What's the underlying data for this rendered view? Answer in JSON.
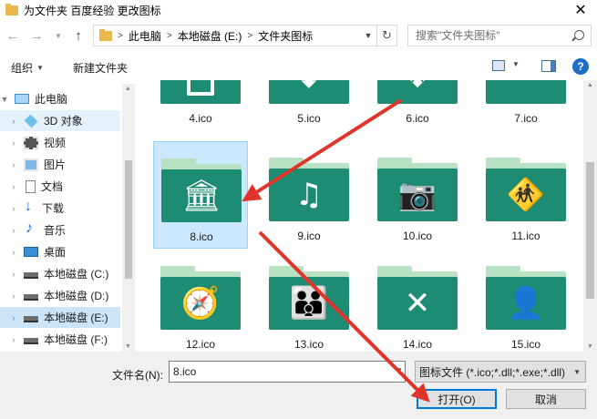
{
  "window": {
    "title": "为文件夹 百度经验 更改图标",
    "close_glyph": "✕"
  },
  "address": {
    "breadcrumbs": [
      "此电脑",
      "本地磁盘 (E:)",
      "文件夹图标"
    ],
    "sep": ">",
    "search_placeholder": "搜索\"文件夹图标\""
  },
  "toolbar": {
    "organize": "组织",
    "new_folder": "新建文件夹",
    "help": "?"
  },
  "sidebar": {
    "items": [
      {
        "label": "此电脑",
        "icon": "computer-icon"
      },
      {
        "label": "3D 对象",
        "icon": "3d-objects-icon"
      },
      {
        "label": "视频",
        "icon": "video-icon"
      },
      {
        "label": "图片",
        "icon": "pictures-icon"
      },
      {
        "label": "文档",
        "icon": "documents-icon"
      },
      {
        "label": "下载",
        "icon": "download-icon"
      },
      {
        "label": "音乐",
        "icon": "music-icon"
      },
      {
        "label": "桌面",
        "icon": "desktop-icon"
      },
      {
        "label": "本地磁盘 (C:)",
        "icon": "drive-icon"
      },
      {
        "label": "本地磁盘 (D:)",
        "icon": "drive-icon"
      },
      {
        "label": "本地磁盘 (E:)",
        "icon": "drive-icon"
      },
      {
        "label": "本地磁盘 (F:)",
        "icon": "drive-icon"
      }
    ]
  },
  "files": [
    {
      "name": "4.ico",
      "glyph": "",
      "icon": "blank-page-icon"
    },
    {
      "name": "5.ico",
      "glyph": "⬇",
      "icon": "download-circle-icon"
    },
    {
      "name": "6.ico",
      "glyph": "❖",
      "icon": "dropbox-icon"
    },
    {
      "name": "7.ico",
      "glyph": "",
      "icon": "folder-icon"
    },
    {
      "name": "8.ico",
      "glyph": "🏛",
      "icon": "bank-icon"
    },
    {
      "name": "9.ico",
      "glyph": "♫",
      "icon": "music-note-icon"
    },
    {
      "name": "10.ico",
      "glyph": "📷",
      "icon": "camera-icon"
    },
    {
      "name": "11.ico",
      "glyph": "🚸",
      "icon": "pedestrian-sign-icon"
    },
    {
      "name": "12.ico",
      "glyph": "🧭",
      "icon": "compass-icon"
    },
    {
      "name": "13.ico",
      "glyph": "👪",
      "icon": "family-icon"
    },
    {
      "name": "14.ico",
      "glyph": "✕",
      "icon": "x-letter-icon"
    },
    {
      "name": "15.ico",
      "glyph": "👤",
      "icon": "user-icon"
    }
  ],
  "footer": {
    "filename_label": "文件名(N):",
    "filename_value": "8.ico",
    "filetype_value": "图标文件 (*.ico;*.dll;*.exe;*.dll)",
    "open_button": "打开(O)",
    "cancel_button": "取消"
  },
  "colors": {
    "folder_front": "#1d8c72",
    "folder_back": "#b9e2c4",
    "selection": "#cce8ff",
    "arrow": "#e0342a"
  }
}
